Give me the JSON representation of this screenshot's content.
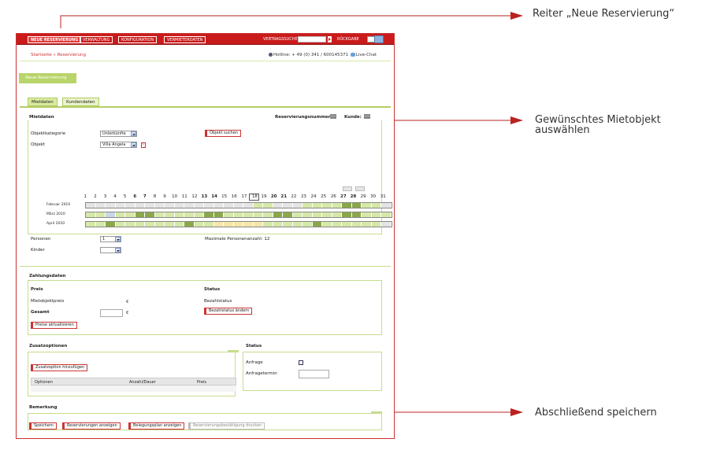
{
  "callouts": {
    "top": "Reiter „Neue Reservierung“",
    "middle_line1": "Gewünschtes Mietobjekt",
    "middle_line2": "auswählen",
    "bottom": "Abschließend speichern"
  },
  "colors": {
    "accent": "#c91b1b",
    "green": "#b3cc66",
    "light_green": "#d6e8a8",
    "dark_green": "#8aa84a",
    "yellow": "#f5e6a8"
  },
  "topnav": {
    "items": [
      "NEUE RESERVIERUNG",
      "VERWALTUNG",
      "KONFIGURATION",
      "VERMIETERDATEN"
    ],
    "search_label": "VERTRAGSSUCHE",
    "back_label": "RÜCKGABE"
  },
  "breadcrumb": "Startseite » Reservierung",
  "hotline": {
    "text": "Hotline: + 49 (0) 341 / 600145371",
    "chat": "Live-Chat"
  },
  "new_reservation_button": "Neue Reservierung",
  "tabs": [
    "Mietdaten",
    "Kundendaten"
  ],
  "mietdaten": {
    "title": "Mietdaten",
    "reservation_number_label": "Reservierungsnummer:",
    "reservation_number_value": "---",
    "customer_label": "Kunde:",
    "customer_value": "---",
    "category_label": "Objektkategorie",
    "category_value": "Unterkünfte",
    "object_label": "Objekt",
    "object_value": "Villa Angela",
    "info": "i",
    "search_object_button": "Objekt suchen",
    "persons_label": "Personen",
    "persons_value": "1",
    "children_label": "Kinder",
    "children_value": "",
    "max_persons": "Maximale Personenanzahl: 12"
  },
  "calendar": {
    "days": [
      "1",
      "2",
      "3",
      "4",
      "5",
      "6",
      "7",
      "8",
      "9",
      "10",
      "11",
      "12",
      "13",
      "14",
      "15",
      "16",
      "17",
      "18",
      "19",
      "20",
      "21",
      "22",
      "23",
      "24",
      "25",
      "26",
      "27",
      "28",
      "29",
      "30",
      "31"
    ],
    "bold_days": [
      "6",
      "7",
      "13",
      "14",
      "20",
      "21",
      "27",
      "28"
    ],
    "selected_day": "18",
    "months": [
      "Februar 2010",
      "März 2010",
      "April 2010"
    ]
  },
  "zahlung": {
    "title": "Zahlungsdaten",
    "price_heading": "Preis",
    "object_price_label": "Mietobjektpreis",
    "currency": "€",
    "total_label": "Gesamt",
    "update_prices_button": "Preise aktualisieren",
    "status_heading": "Status",
    "payment_status_label": "Bezahlstatus",
    "change_status_button": "Bezahlstatus ändern"
  },
  "zusatz": {
    "title": "Zusatzoptionen",
    "add_button": "Zusatzoption hinzufügen",
    "columns": [
      "Optionen",
      "Anzahl/Dauer",
      "Preis"
    ]
  },
  "status_box": {
    "title": "Status",
    "request_label": "Anfrage",
    "request_date_label": "Anfragetermin"
  },
  "bemerkung": {
    "title": "Bemerkung"
  },
  "footer_buttons": [
    "Speichern",
    "Reservierungen anzeigen",
    "Belegungsplan anzeigen",
    "Reservierungsbestätigung drucken"
  ]
}
